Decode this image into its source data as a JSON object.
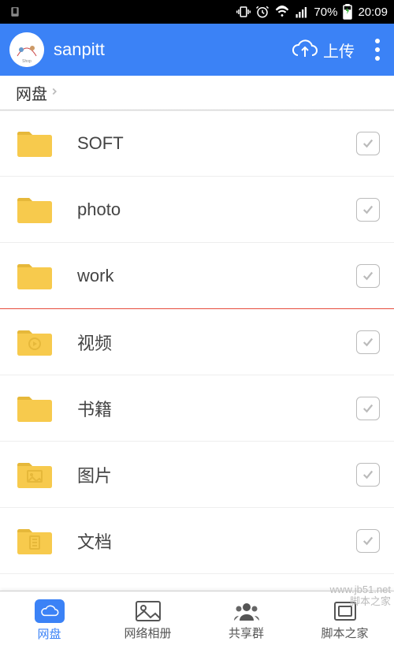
{
  "status": {
    "battery_pct": "70%",
    "time": "20:09"
  },
  "header": {
    "username": "sanpitt",
    "upload_label": "上传"
  },
  "breadcrumb": {
    "current": "网盘"
  },
  "folders": [
    {
      "name": "SOFT",
      "type": "plain"
    },
    {
      "name": "photo",
      "type": "plain"
    },
    {
      "name": "work",
      "type": "plain"
    },
    {
      "name": "视频",
      "type": "video"
    },
    {
      "name": "书籍",
      "type": "plain"
    },
    {
      "name": "图片",
      "type": "image"
    },
    {
      "name": "文档",
      "type": "doc"
    }
  ],
  "bottom_nav": {
    "items": [
      {
        "label": "网盘"
      },
      {
        "label": "网络相册"
      },
      {
        "label": "共享群"
      },
      {
        "label": "脚本之家"
      }
    ]
  },
  "watermark": {
    "line1": "www.jb51.net",
    "line2": "脚本之家"
  }
}
